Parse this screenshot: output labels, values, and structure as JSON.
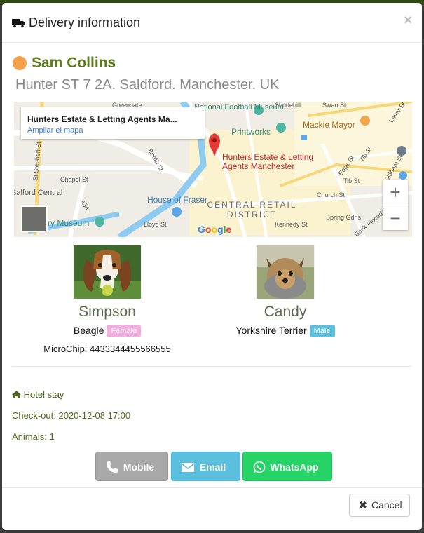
{
  "modal": {
    "title": "Delivery information",
    "close_label": "×"
  },
  "client": {
    "name": "Sam Collins",
    "address": "Hunter ST 7 2A. Saldford. Manchester. UK",
    "status_color": "#f5a04a"
  },
  "map": {
    "card_title": "Hunters Estate & Letting Agents Ma...",
    "card_link": "Ampliar el mapa",
    "pin_label": "Hunters Estate & Letting Agents Manchester",
    "labels": [
      "National Football Museum",
      "Printworks",
      "Mackie Mayor",
      "House of Fraser",
      "CENTRAL RETAIL DISTRICT",
      "Salford Central",
      "ry Museum",
      "Booth St",
      "Chapel St",
      "A34",
      "Church St",
      "Back Piccadilly",
      "Edge St",
      "Tib St",
      "Oldham St",
      "Lever St",
      "Spring Gdns",
      "Kennedy St",
      "St Stephen St",
      "Lloyd St",
      "Tib St",
      "Swan St",
      "Shudehill",
      "Greengate"
    ],
    "zoom_in": "+",
    "zoom_out": "−",
    "logo": "Google"
  },
  "pets": [
    {
      "name": "Simpson",
      "breed": "Beagle",
      "sex": "Female",
      "microchip": "MicroChip: 4433344455566555"
    },
    {
      "name": "Candy",
      "breed": "Yorkshire Terrier",
      "sex": "Male"
    }
  ],
  "service": {
    "type": "Hotel stay",
    "checkout": "Check-out: 2020-12-08 17:00",
    "animals": "Animals: 1"
  },
  "buttons": {
    "mobile": "Mobile",
    "email": "Email",
    "whatsapp": "WhatsApp",
    "cancel": "Cancel"
  },
  "icons": {
    "truck": "truck-icon",
    "home": "home-icon",
    "phone": "phone-icon",
    "envelope": "envelope-icon",
    "whatsapp": "whatsapp-icon",
    "close": "close-icon"
  },
  "colors": {
    "brand_green": "#5b7d1a",
    "female": "#f3aee0",
    "male": "#5bc0de",
    "whatsapp": "#25d366"
  }
}
